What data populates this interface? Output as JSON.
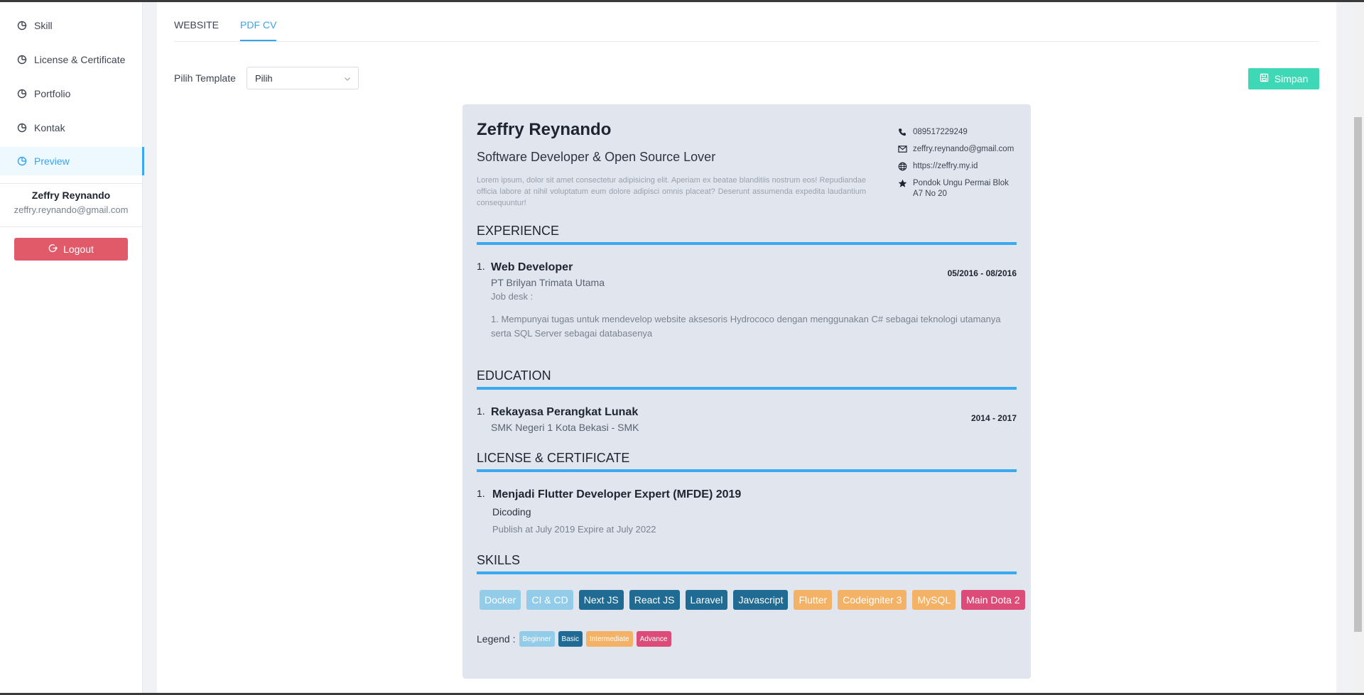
{
  "sidebar": {
    "items": [
      {
        "label": "Skill",
        "icon": "pie-chart-icon"
      },
      {
        "label": "License & Certificate",
        "icon": "pie-chart-icon"
      },
      {
        "label": "Portfolio",
        "icon": "pie-chart-icon"
      },
      {
        "label": "Kontak",
        "icon": "pie-chart-icon"
      },
      {
        "label": "Preview",
        "icon": "pie-chart-icon",
        "active": true
      }
    ],
    "user": {
      "name": "Zeffry Reynando",
      "email": "zeffry.reynando@gmail.com"
    },
    "logout_label": "Logout"
  },
  "tabs": [
    {
      "label": "WEBSITE",
      "active": false
    },
    {
      "label": "PDF CV",
      "active": true
    }
  ],
  "template": {
    "label": "Pilih Template",
    "selected": "Pilih"
  },
  "save_label": "Simpan",
  "cv": {
    "name": "Zeffry Reynando",
    "title": "Software Developer & Open Source Lover",
    "summary": "Lorem ipsum, dolor sit amet consectetur adipisicing elit. Aperiam ex beatae blanditiis nostrum eos! Repudiandae officia labore at nihil voluptatum eum dolore adipisci omnis placeat? Deserunt assumenda expedita laudantium consequuntur!",
    "contacts": {
      "phone": "089517229249",
      "email": "zeffry.reynando@gmail.com",
      "website": "https://zeffry.my.id",
      "address": "Pondok Ungu Permai Blok A7 No 20"
    },
    "experience": {
      "heading": "EXPERIENCE",
      "items": [
        {
          "num": "1.",
          "role": "Web Developer",
          "company": "PT Brilyan Trimata Utama",
          "date": "05/2016 - 08/2016",
          "job_label": "Job desk :",
          "desc": "1. Mempunyai tugas untuk mendevelop website aksesoris Hydrococo dengan menggunakan C# sebagai teknologi utamanya serta SQL Server sebagai databasenya"
        }
      ]
    },
    "education": {
      "heading": "EDUCATION",
      "items": [
        {
          "num": "1.",
          "major": "Rekayasa Perangkat Lunak",
          "school": "SMK Negeri 1 Kota Bekasi - SMK",
          "date": "2014 - 2017"
        }
      ]
    },
    "license": {
      "heading": "LICENSE & CERTIFICATE",
      "items": [
        {
          "num": "1.",
          "name": "Menjadi Flutter Developer Expert (MFDE) 2019",
          "issuer": "Dicoding",
          "validity": "Publish at July 2019 Expire at July 2022"
        }
      ]
    },
    "skills": {
      "heading": "SKILLS",
      "items": [
        {
          "name": "Docker",
          "level": "beginner"
        },
        {
          "name": "CI & CD",
          "level": "beginner"
        },
        {
          "name": "Next JS",
          "level": "basic"
        },
        {
          "name": "React JS",
          "level": "basic"
        },
        {
          "name": "Laravel",
          "level": "basic"
        },
        {
          "name": "Javascript",
          "level": "basic"
        },
        {
          "name": "Flutter",
          "level": "intermediate"
        },
        {
          "name": "Codeigniter 3",
          "level": "intermediate"
        },
        {
          "name": "MySQL",
          "level": "intermediate"
        },
        {
          "name": "Main Dota 2",
          "level": "advance"
        }
      ],
      "legend_label": "Legend :",
      "legend": [
        {
          "name": "Beginner",
          "level": "beginner"
        },
        {
          "name": "Basic",
          "level": "basic"
        },
        {
          "name": "Intermediate",
          "level": "intermediate"
        },
        {
          "name": "Advance",
          "level": "advance"
        }
      ],
      "level_colors": {
        "beginner": "#92cce9",
        "basic": "#1f6b94",
        "intermediate": "#f4b266",
        "advance": "#dd4b78"
      }
    }
  },
  "colors": {
    "accent": "#35a5f0",
    "save_button": "#3ed8b7",
    "logout_button": "#e05a6a",
    "cv_background": "#e1e6ee"
  }
}
